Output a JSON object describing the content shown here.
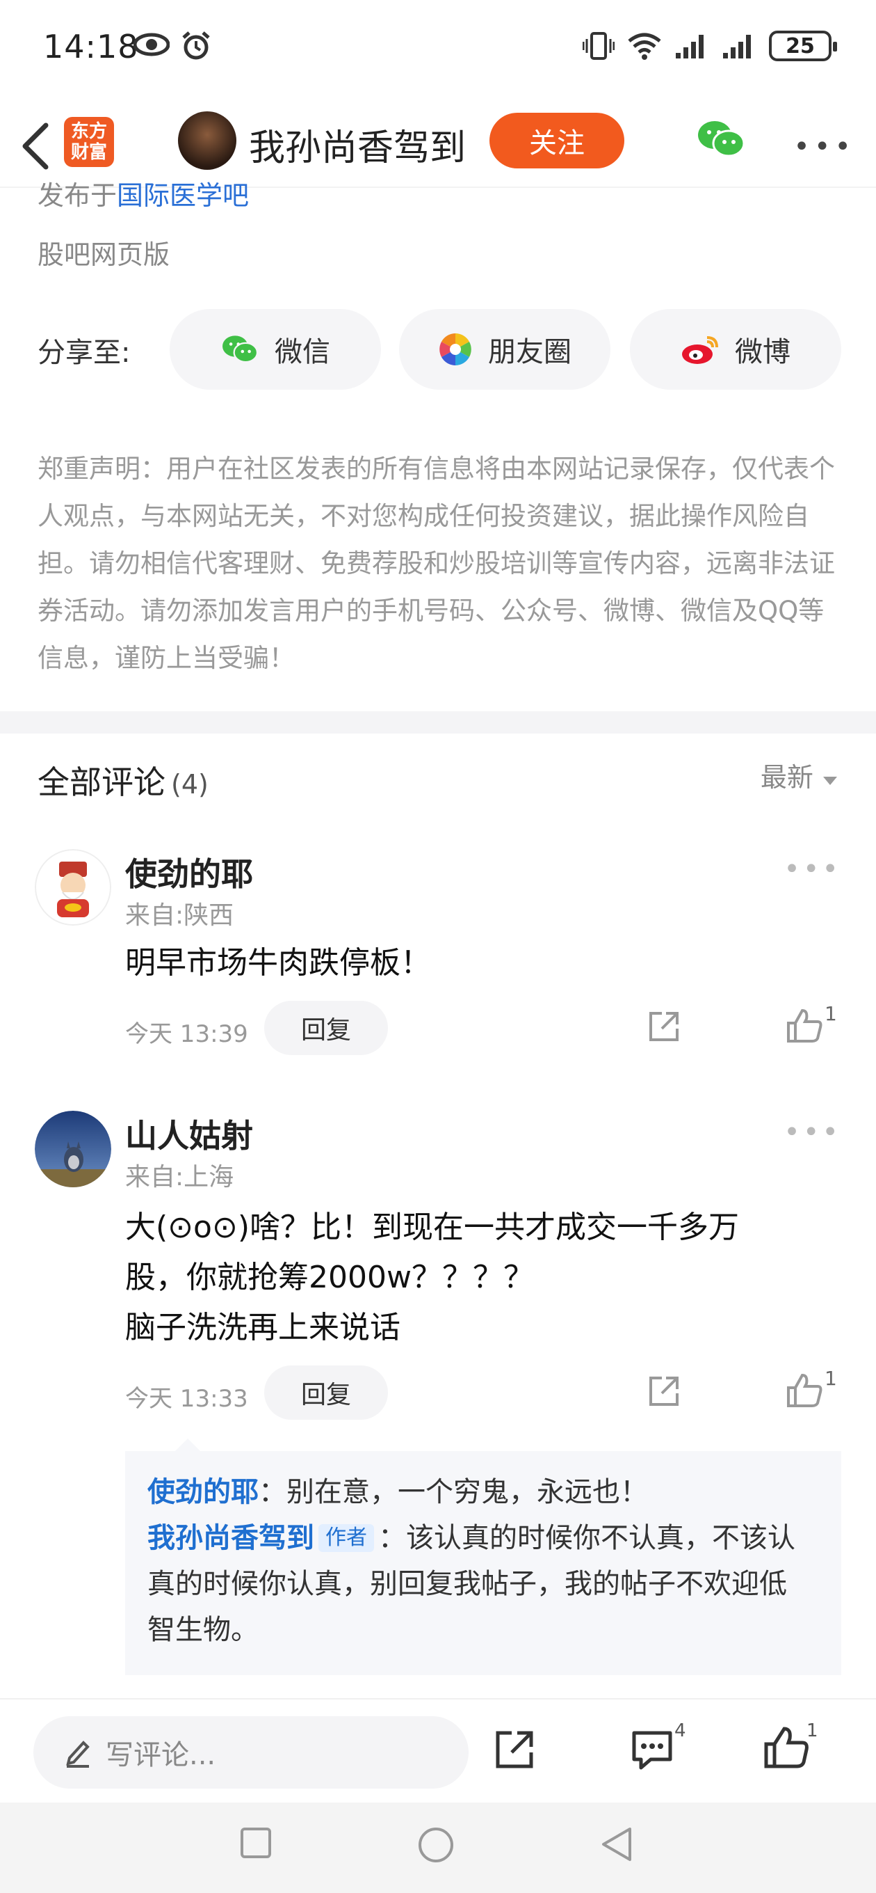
{
  "status_bar": {
    "time": "14:18",
    "battery": "25"
  },
  "nav": {
    "brand_text_line1": "东方",
    "brand_text_line2": "财富",
    "author_name": "我孙尚香驾到",
    "follow_label": "关注"
  },
  "meta": {
    "source_prefix": "发布于",
    "source_link": "国际医学吧",
    "web_label": "股吧网页版"
  },
  "share": {
    "label": "分享至:",
    "wechat": "微信",
    "moments": "朋友圈",
    "weibo": "微博"
  },
  "disclaimer": "郑重声明：用户在社区发表的所有信息将由本网站记录保存，仅代表个人观点，与本网站无关，不对您构成任何投资建议，据此操作风险自担。请勿相信代客理财、免费荐股和炒股培训等宣传内容，远离非法证券活动。请勿添加发言用户的手机号码、公众号、微博、微信及QQ等信息，谨防上当受骗！",
  "comments_header": {
    "title": "全部评论",
    "count": "(4)",
    "sort": "最新"
  },
  "comments": [
    {
      "name": "使劲的耶",
      "location": "来自:陕西",
      "body": "明早市场牛肉跌停板！",
      "time": "今天 13:39",
      "reply_label": "回复",
      "likes": "1"
    },
    {
      "name": "山人姑射",
      "location": "来自:上海",
      "body_line1": "大(⊙o⊙)啥？比！到现在一共才成交一千多万",
      "body_line2": "股，你就抢筹2000w？？？？",
      "body_line3": "脑子洗洗再上来说话",
      "time": "今天 13:33",
      "reply_label": "回复",
      "likes": "1"
    }
  ],
  "replies": [
    {
      "user": "使劲的耶",
      "text": "：别在意，一个穷鬼，永远也！"
    },
    {
      "user": "我孙尚香驾到",
      "tag": "作者",
      "text_line1": "：该认真的时候你不认真，不该认",
      "text_line2": "真的时候你认真，别回复我帖子，我的帖子不欢迎低",
      "text_line3": "智生物。"
    }
  ],
  "bottom_bar": {
    "write_placeholder": "写评论...",
    "comment_count": "4",
    "like_count": "1"
  },
  "colors": {
    "accent": "#f25a1e",
    "link": "#1f6fd0"
  }
}
